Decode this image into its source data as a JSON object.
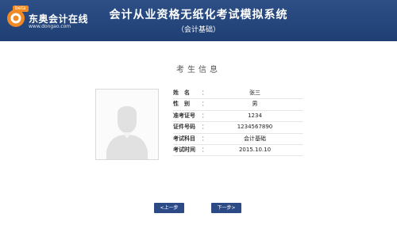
{
  "header": {
    "brand_badge": "beta",
    "brand_name": "东奥会计在线",
    "brand_url": "www.dongao.com",
    "title": "会计从业资格无纸化考试模拟系统",
    "subtitle": "（会计基础）",
    "bg_color": "#2a4a82"
  },
  "section": {
    "title": "考生信息"
  },
  "candidate": {
    "photo": "avatar-placeholder",
    "fields": [
      {
        "label": "姓　名",
        "colon": "：",
        "value": "张三"
      },
      {
        "label": "性　别",
        "colon": "：",
        "value": "男"
      },
      {
        "label": "准考证号",
        "colon": "：",
        "value": "1234"
      },
      {
        "label": "证件号码",
        "colon": "：",
        "value": "1234567890"
      },
      {
        "label": "考试科目",
        "colon": "：",
        "value": "会计基础"
      },
      {
        "label": "考试时间",
        "colon": "：",
        "value": "2015.10.10"
      }
    ]
  },
  "buttons": {
    "prev_label": "<上一步",
    "next_label": "下一步>",
    "color": "#2b4a86"
  }
}
